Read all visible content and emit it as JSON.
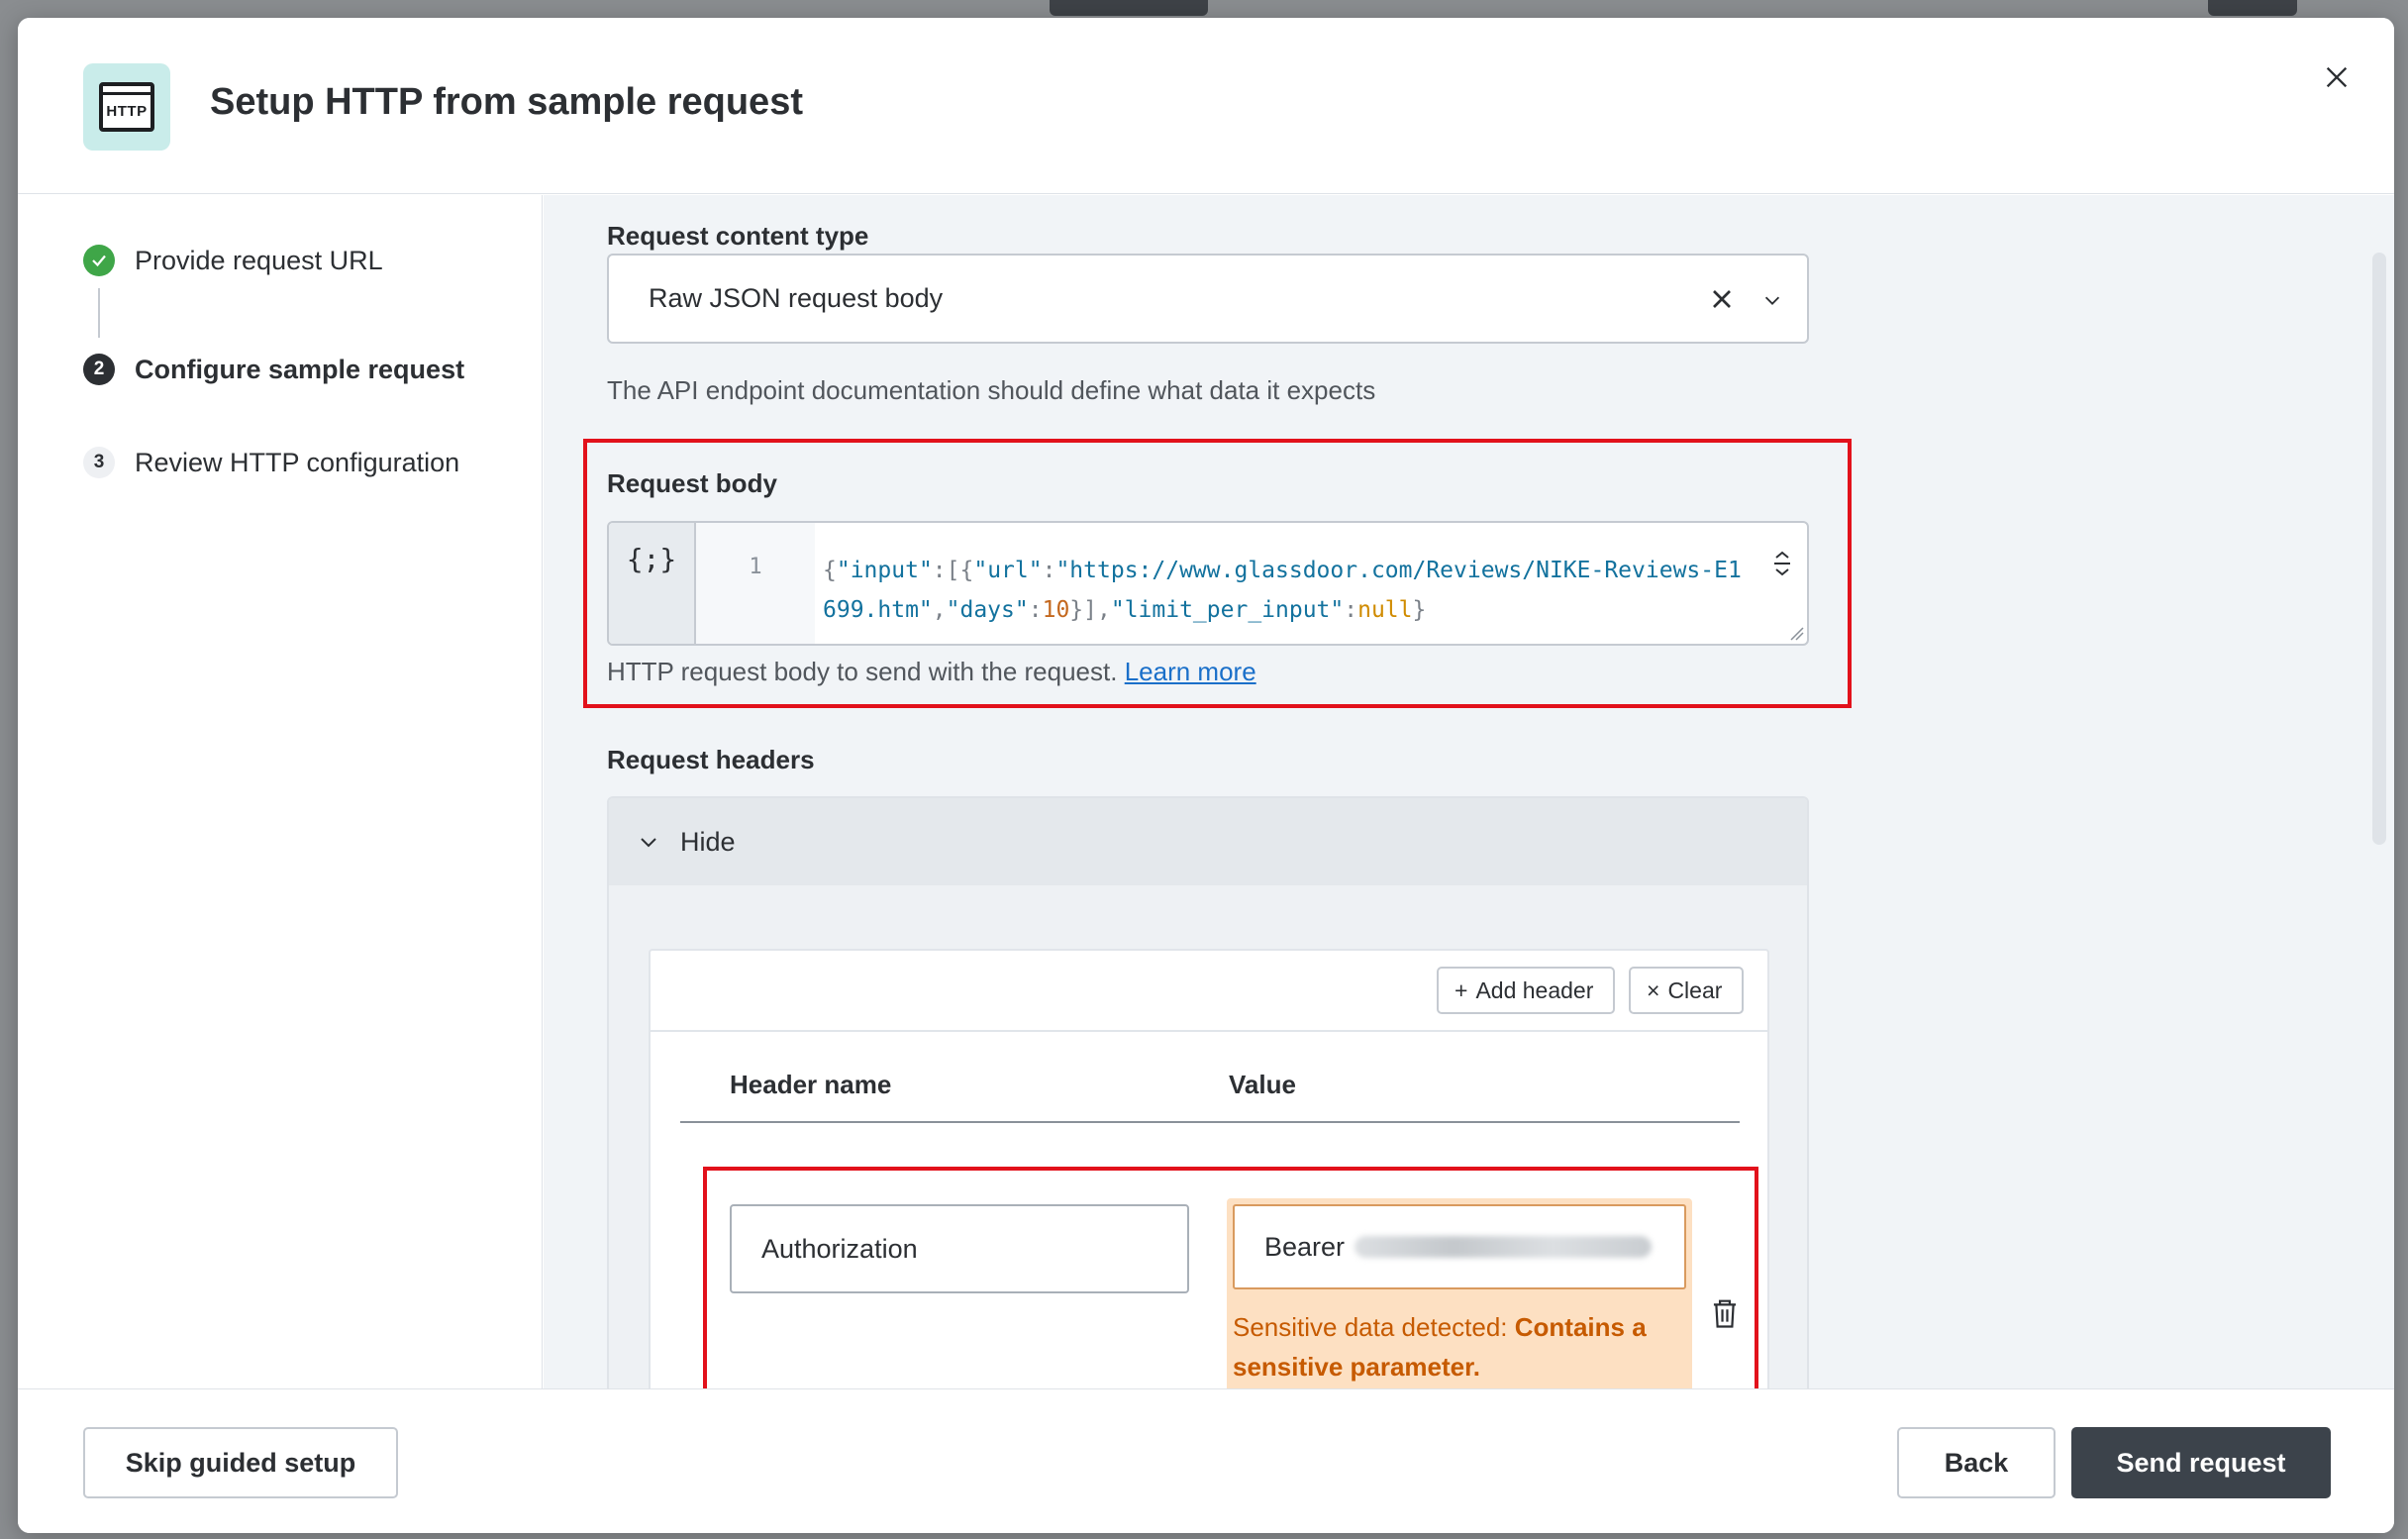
{
  "modal": {
    "icon_text": "HTTP",
    "title": "Setup HTTP from sample request"
  },
  "steps": [
    {
      "number": "✓",
      "label": "Provide request URL",
      "state": "done"
    },
    {
      "number": "2",
      "label": "Configure sample request",
      "state": "active"
    },
    {
      "number": "3",
      "label": "Review HTTP configuration",
      "state": "todo"
    }
  ],
  "content_type": {
    "label": "Request content type",
    "value": "Raw JSON request body",
    "hint": "The API endpoint documentation should define what data it expects"
  },
  "request_body": {
    "label": "Request body",
    "editor_icon": "{;}",
    "line_number": "1",
    "code": "{\"input\":[{\"url\":\"https://www.glassdoor.com/Reviews/NIKE-Reviews-E1699.htm\",\"days\":10}],\"limit_per_input\":null}",
    "hint": "HTTP request body to send with the request.",
    "learn_more": "Learn more"
  },
  "request_headers": {
    "label": "Request headers",
    "toggle_label": "Hide",
    "add_header": "Add header",
    "clear": "Clear",
    "col_name": "Header name",
    "col_value": "Value",
    "row": {
      "name": "Authorization",
      "value_prefix": "Bearer",
      "warning_prefix": "Sensitive data detected: ",
      "warning_bold": "Contains a sensitive parameter."
    }
  },
  "footer": {
    "skip": "Skip guided setup",
    "back": "Back",
    "send": "Send request"
  },
  "colors": {
    "primary_button": "#3c434b",
    "step_done": "#3fa648",
    "highlight": "#e2111b",
    "warning_bg": "#fde0c2",
    "warning_text": "#c65a00",
    "link": "#1a6fc9"
  }
}
